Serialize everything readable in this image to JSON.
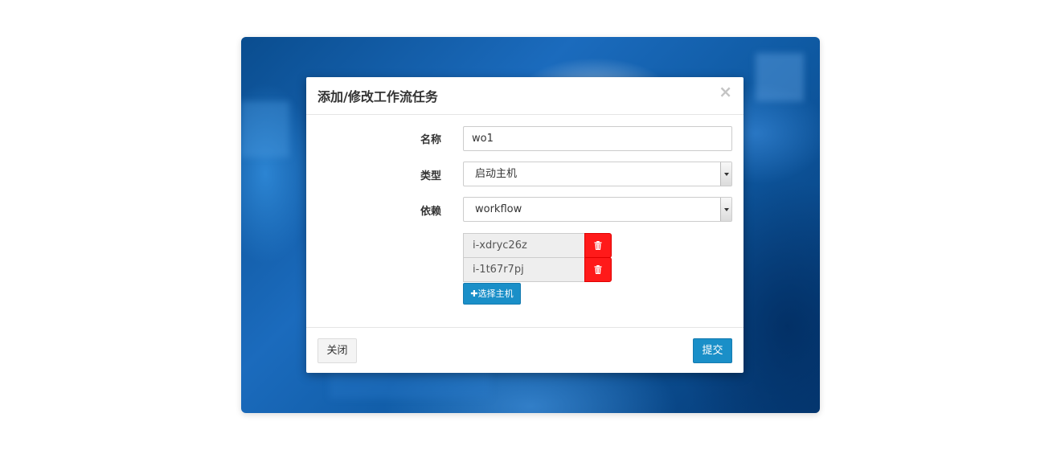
{
  "modal": {
    "title": "添加/修改工作流任务",
    "close_glyph": "×"
  },
  "form": {
    "name_label": "名称",
    "name_value": "wo1",
    "type_label": "类型",
    "type_value": "启动主机",
    "depend_label": "依赖",
    "depend_value": "workflow"
  },
  "hosts": [
    {
      "name": "i-xdryc26z"
    },
    {
      "name": "i-1t67r7pj"
    }
  ],
  "select_host_button": {
    "icon": "plus-icon",
    "label": "✚选择主机"
  },
  "footer": {
    "close_label": "关闭",
    "submit_label": "提交"
  },
  "colors": {
    "primary": "#1a8fc8",
    "danger": "#ff1a1a"
  }
}
